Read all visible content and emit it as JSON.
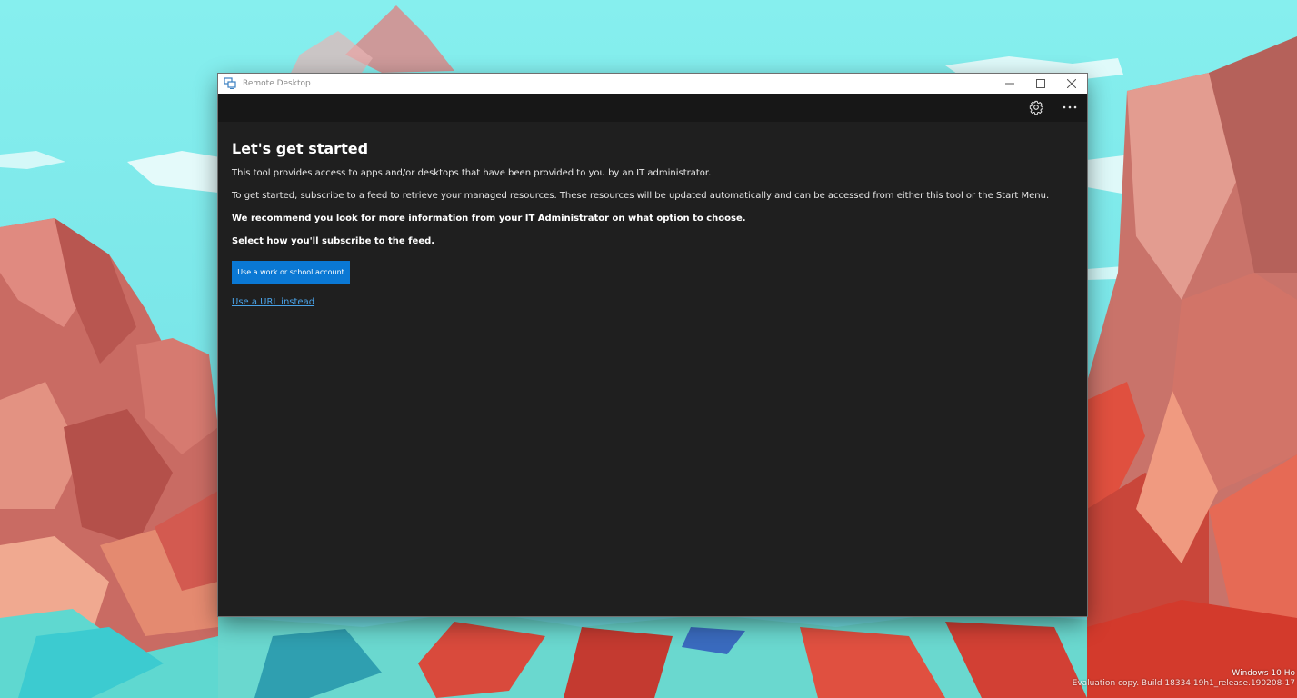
{
  "window": {
    "title": "Remote Desktop"
  },
  "toolbar": {
    "settings_icon": "gear-icon",
    "more_icon": "more-horizontal-icon"
  },
  "content": {
    "heading": "Let's get started",
    "paragraph_1": "This tool provides access to apps and/or desktops that have been provided to you by an IT administrator.",
    "paragraph_2": "To get started, subscribe to a feed to retrieve your managed resources. These resources will be updated automatically and can be accessed from either this tool or the Start Menu.",
    "paragraph_3": "We recommend you look for more information from your IT Administrator on what option to choose.",
    "paragraph_4": "Select how you'll subscribe to the feed.",
    "primary_button": "Use a work or school account",
    "link": "Use a URL instead"
  },
  "desktop": {
    "watermark_line_1": "Windows 10 Ho",
    "watermark_line_2": "Evaluation copy. Build 18334.19h1_release.190208-17"
  },
  "colors": {
    "accent": "#0a78d4",
    "link": "#4aa3e8",
    "window_bg": "#1f1f1f",
    "toolbar_bg": "#171717"
  }
}
